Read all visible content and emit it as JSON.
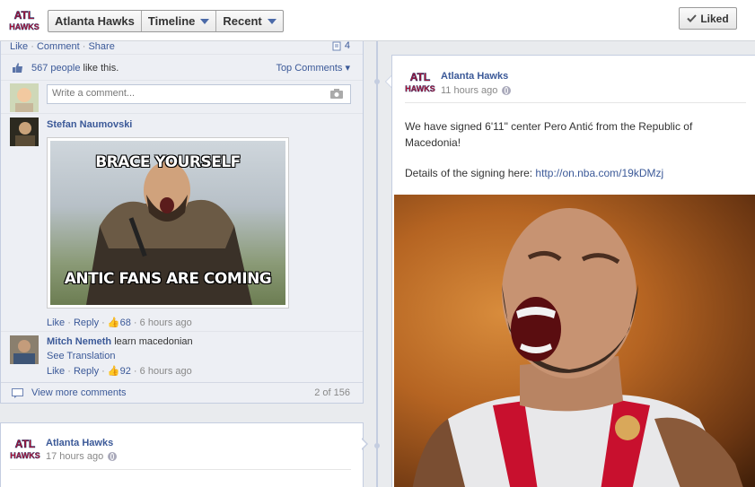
{
  "header": {
    "logo_text_top": "ATL",
    "logo_text_bottom": "HAWKS",
    "crumbs": [
      {
        "label": "Atlanta Hawks",
        "dropdown": false
      },
      {
        "label": "Timeline",
        "dropdown": true
      },
      {
        "label": "Recent",
        "dropdown": true
      }
    ],
    "liked_label": "Liked"
  },
  "left_post": {
    "actions": {
      "like": "Like",
      "comment": "Comment",
      "share": "Share",
      "sep": "·",
      "comment_count": "4"
    },
    "likes": {
      "count_text": "567 people",
      "suffix": " like this.",
      "top_comments": "Top Comments"
    },
    "write_placeholder": "Write a comment...",
    "comments": [
      {
        "author": "Stefan Naumovski",
        "text": "",
        "meme_top": "BRACE YOURSELF",
        "meme_bottom": "ANTIC FANS ARE COMING",
        "like": "Like",
        "reply": "Reply",
        "likes": "68",
        "time": "6 hours ago"
      },
      {
        "author": "Mitch Nemeth",
        "text": "learn macedonian",
        "see_translation": "See Translation",
        "like": "Like",
        "reply": "Reply",
        "likes": "92",
        "time": "6 hours ago"
      }
    ],
    "view_more": "View more comments",
    "pager": "2 of 156"
  },
  "left_post2": {
    "author": "Atlanta Hawks",
    "time": "17 hours ago"
  },
  "right_post": {
    "author": "Atlanta Hawks",
    "time": "11 hours ago",
    "text_line1": "We have signed 6'11\" center Pero Antić from the Republic of Macedonia!",
    "details_prefix": "Details of the signing here: ",
    "details_link": "http://on.nba.com/19kDMzj"
  },
  "colors": {
    "fb_blue": "#3b5998",
    "hawks_red": "#c8102e",
    "hawks_navy": "#1d2a63"
  }
}
